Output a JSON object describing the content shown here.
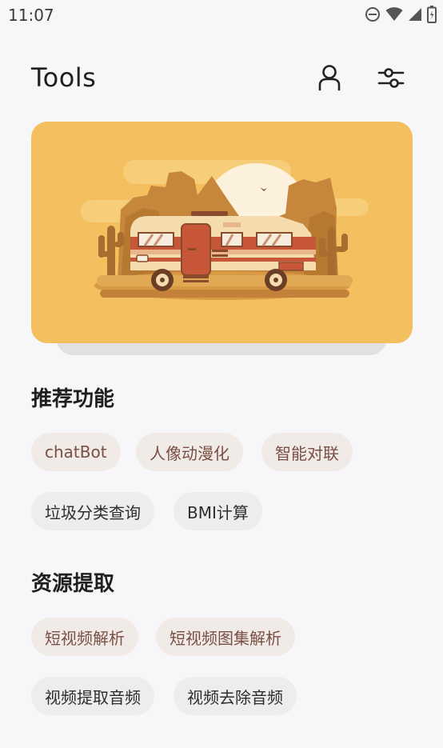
{
  "status_bar": {
    "time": "11:07",
    "icons": [
      "do-not-disturb-icon",
      "wifi-icon",
      "cell-signal-icon",
      "battery-icon"
    ]
  },
  "header": {
    "title": "Tools",
    "actions": [
      "user-icon",
      "sliders-icon"
    ]
  },
  "banner": {
    "illustration": "camper-van-desert",
    "colors": {
      "background": "#f3bf5f",
      "van_stripe": "#c8573a",
      "sun": "#fbf1dc"
    }
  },
  "sections": [
    {
      "title": "推荐功能",
      "items": [
        {
          "label": "chatBot",
          "highlight": true
        },
        {
          "label": "人像动漫化",
          "highlight": true
        },
        {
          "label": "智能对联",
          "highlight": true
        },
        {
          "label": "垃圾分类查询",
          "highlight": false
        },
        {
          "label": "BMI计算",
          "highlight": false
        }
      ]
    },
    {
      "title": "资源提取",
      "items": [
        {
          "label": "短视频解析",
          "highlight": true
        },
        {
          "label": "短视频图集解析",
          "highlight": true
        },
        {
          "label": "视频提取音频",
          "highlight": false
        },
        {
          "label": "视频去除音频",
          "highlight": false
        }
      ]
    }
  ],
  "theme": {
    "accent_chip_bg": "#f1ebe8",
    "accent_chip_text": "#7a4f44",
    "chip_bg": "#eeedee"
  }
}
